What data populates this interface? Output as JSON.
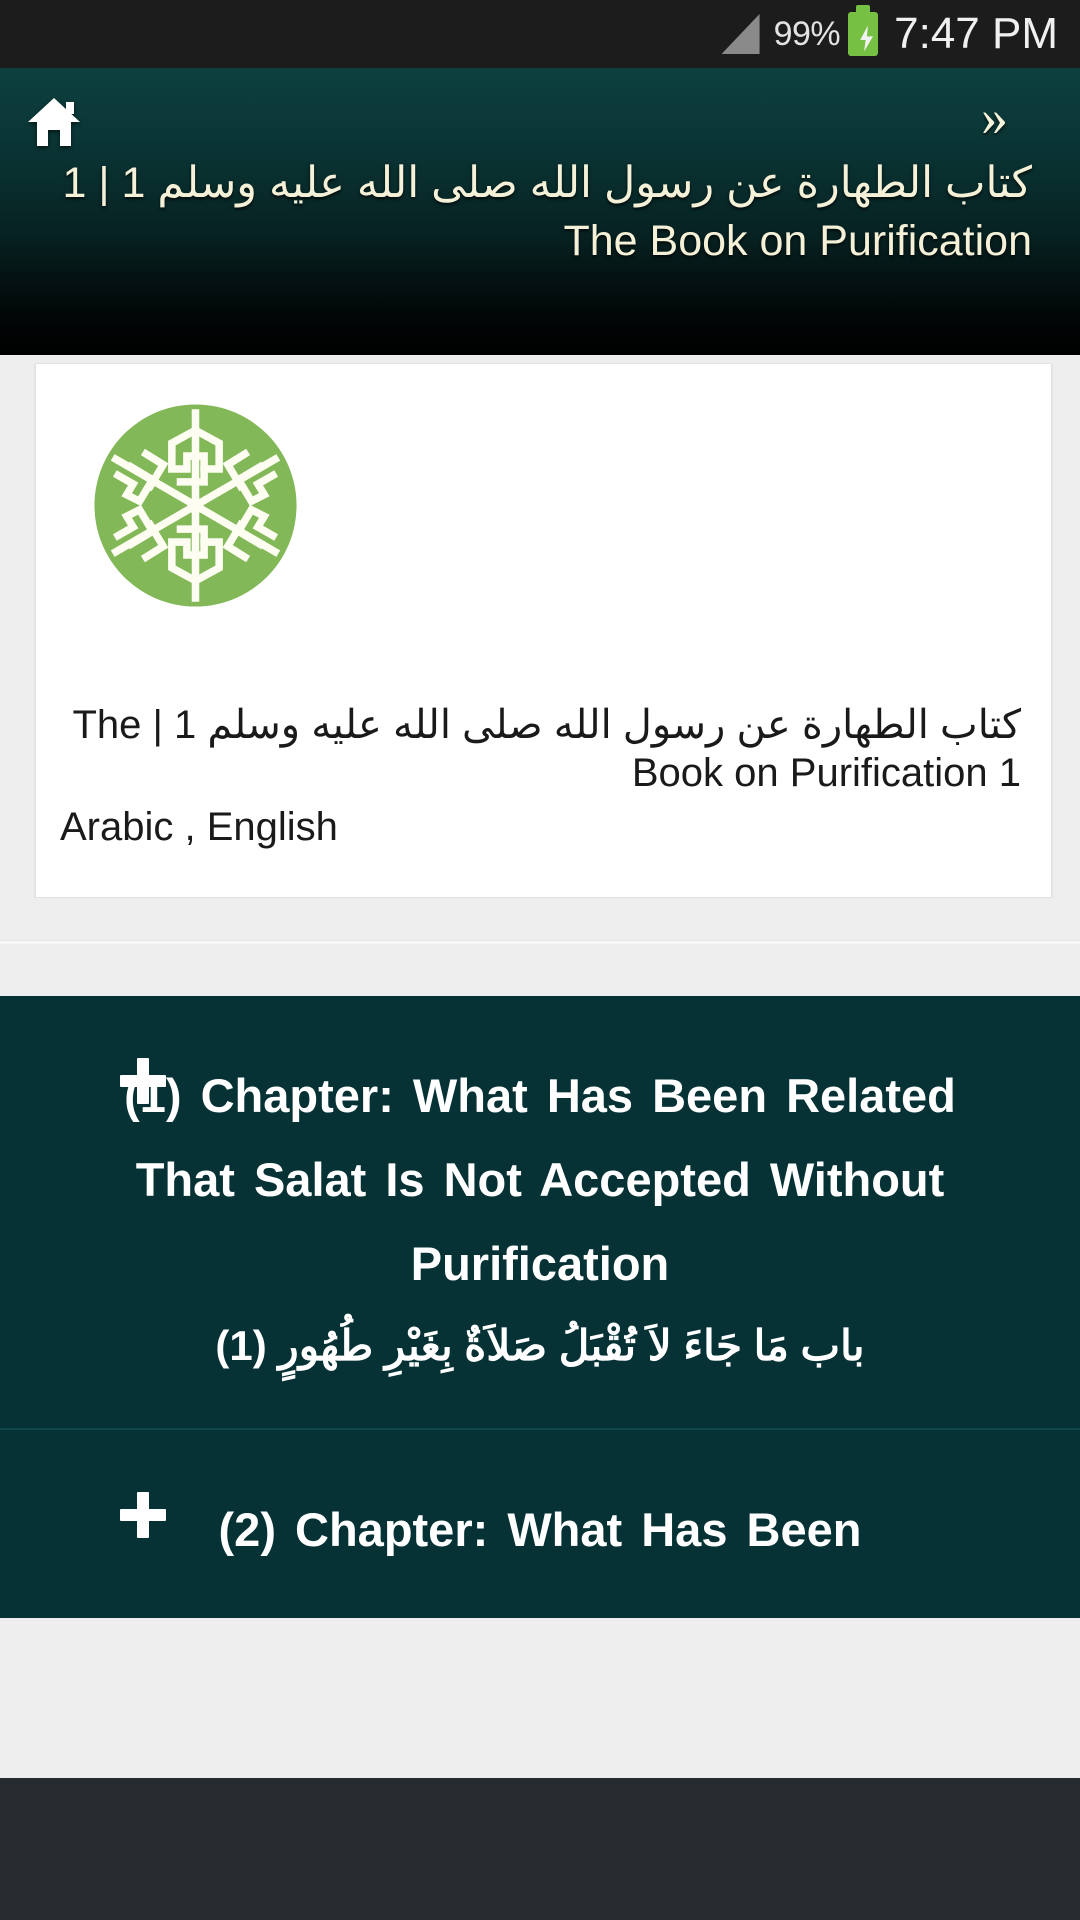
{
  "status_bar": {
    "battery_percent": "99%",
    "time": "7:47 PM",
    "signal_icon": "signal-triangle-icon",
    "battery_icon": "battery-charging-icon"
  },
  "app_bar": {
    "home_icon": "home-icon",
    "overflow_icon": "double-chevron-right-icon",
    "title_en": "1 The Book on Purification",
    "title_separator": "|",
    "title_ar": "كتاب الطهارة عن رسول الله صلى الله عليه وسلم 1"
  },
  "book_card": {
    "logo_icon": "islamic-geometric-logo-icon",
    "title_en": "The Book on Purification 1",
    "title_separator": "|",
    "title_ar": "كتاب الطهارة عن رسول الله صلى الله عليه وسلم 1",
    "languages": "Arabic , English"
  },
  "chapters": [
    {
      "expand_icon": "plus-icon",
      "title_en": "(1) Chapter: What Has Been Related That Salat Is Not Accepted Without Purification",
      "title_ar": "باب مَا جَاءَ لاَ تُقْبَلُ صَلاَةٌ بِغَيْرِ طُهُورٍ (1)"
    },
    {
      "expand_icon": "plus-icon",
      "title_en": "(2) Chapter: What Has Been",
      "title_ar": ""
    }
  ],
  "colors": {
    "app_bar_top": "#0e4040",
    "app_bar_bottom": "#000000",
    "chapter_bg": "#063235",
    "accent_cream": "#f4f1d8",
    "logo_green": "#82b857",
    "battery_green": "#76c043",
    "page_bg": "#eeeeee",
    "nav_bar": "#262b30"
  }
}
